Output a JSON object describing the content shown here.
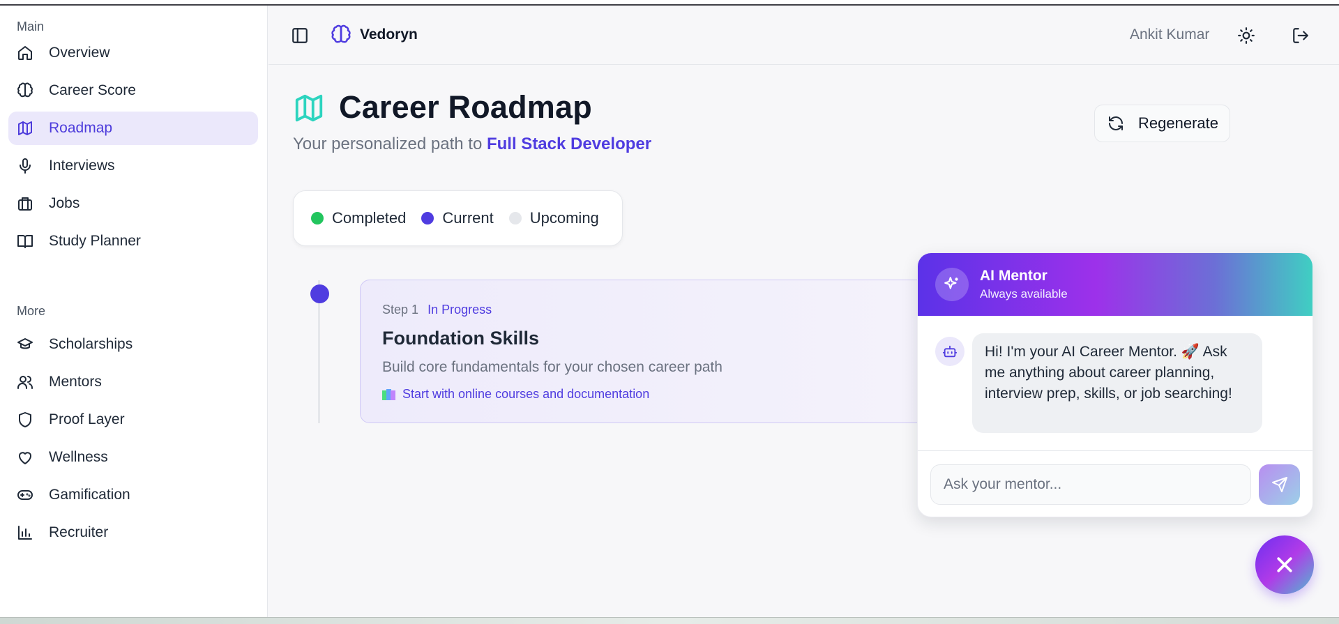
{
  "app": {
    "brand": "Vedoryn",
    "user_name": "Ankit Kumar"
  },
  "sidebar": {
    "main_label": "Main",
    "main_items": [
      {
        "label": "Overview",
        "icon": "home-icon"
      },
      {
        "label": "Career Score",
        "icon": "brain-icon"
      },
      {
        "label": "Roadmap",
        "icon": "map-icon",
        "active": true
      },
      {
        "label": "Interviews",
        "icon": "mic-icon"
      },
      {
        "label": "Jobs",
        "icon": "briefcase-icon"
      },
      {
        "label": "Study Planner",
        "icon": "book-icon"
      }
    ],
    "more_label": "More",
    "more_items": [
      {
        "label": "Scholarships",
        "icon": "graduation-cap-icon"
      },
      {
        "label": "Mentors",
        "icon": "users-icon"
      },
      {
        "label": "Proof Layer",
        "icon": "shield-icon"
      },
      {
        "label": "Wellness",
        "icon": "heart-icon"
      },
      {
        "label": "Gamification",
        "icon": "gamepad-icon"
      },
      {
        "label": "Recruiter",
        "icon": "bar-chart-icon"
      }
    ]
  },
  "page": {
    "title": "Career Roadmap",
    "subtitle_prefix": "Your personalized path to",
    "target_role": "Full Stack Developer",
    "regenerate_label": "Regenerate"
  },
  "legend": [
    {
      "label": "Completed",
      "color": "#22c55e"
    },
    {
      "label": "Current",
      "color": "#4f3ce0"
    },
    {
      "label": "Upcoming",
      "color": "#e5e7eb"
    }
  ],
  "steps": [
    {
      "number_label": "Step 1",
      "status": "In Progress",
      "title": "Foundation Skills",
      "description": "Build core fundamentals for your chosen career path",
      "resource": "Start with online courses and documentation"
    }
  ],
  "chat": {
    "title": "AI Mentor",
    "status": "Always available",
    "greeting": "Hi! I'm your AI Career Mentor. 🚀 Ask me anything about career planning, interview prep, skills, or job searching!",
    "input_placeholder": "Ask your mentor..."
  },
  "colors": {
    "accent": "#4f3ce0",
    "active_bg": "#ebe8fb",
    "title_icon": "#2dd4bf"
  }
}
